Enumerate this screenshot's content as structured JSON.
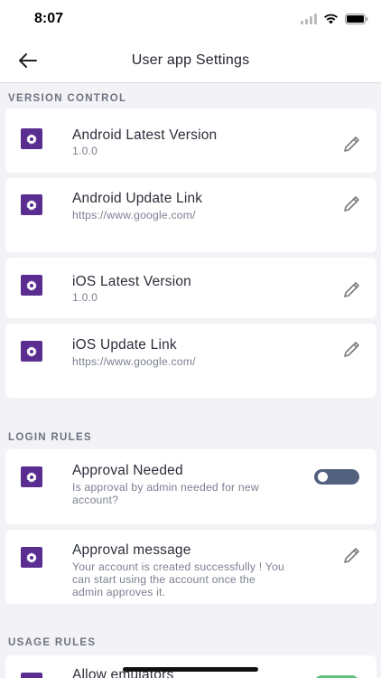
{
  "status_bar": {
    "time": "8:07"
  },
  "nav": {
    "title": "User app Settings"
  },
  "sections": {
    "version_control": "VERSION CONTROL",
    "login_rules": "LOGIN RULES",
    "usage_rules": "USAGE RULES"
  },
  "version_control": {
    "android_latest": {
      "title": "Android Latest Version",
      "value": "1.0.0"
    },
    "android_link": {
      "title": "Android Update Link",
      "value": "https://www.google.com/"
    },
    "ios_latest": {
      "title": "iOS Latest Version",
      "value": "1.0.0"
    },
    "ios_link": {
      "title": "iOS Update Link",
      "value": "https://www.google.com/"
    }
  },
  "login_rules": {
    "approval_needed": {
      "title": "Approval Needed",
      "description_line1": "Is approval by admin needed for new",
      "description_line2": "account?",
      "enabled": false
    },
    "approval_message": {
      "title": "Approval message",
      "line1": "Your account is created successfully ! You",
      "line2": "can start using the account once the",
      "line3": "admin approves it."
    }
  },
  "usage_rules": {
    "allow_emulators": {
      "title": "Allow emulators",
      "enabled": true
    }
  },
  "icons": {
    "settings": "settings-icon",
    "edit": "pencil-icon",
    "back": "arrow-left-icon"
  },
  "colors": {
    "icon_bg": "#5a2d91",
    "toggle_off": "#53617f",
    "toggle_on": "#5fc080",
    "background": "#f2f2f7"
  }
}
